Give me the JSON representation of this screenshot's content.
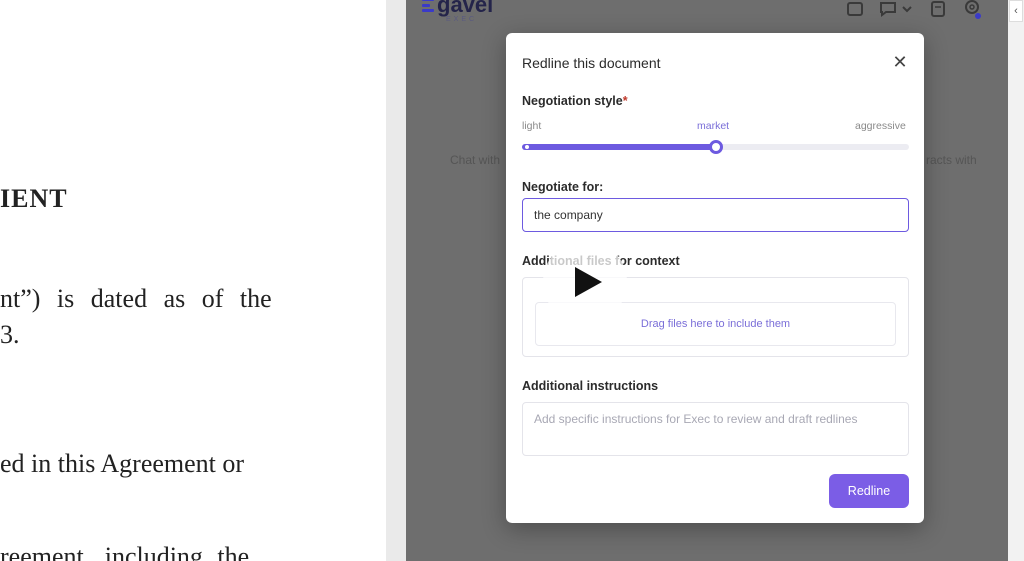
{
  "document": {
    "heading_fragment": "IENT",
    "line1": "nt”) is dated as of the",
    "line2": "3.",
    "line3": "ed in this Agreement or",
    "line4": "reement, including the"
  },
  "app": {
    "logo_text": "gavel",
    "logo_subtext": "EXEC",
    "background_hint_left": "Chat with",
    "background_hint_right": "racts with",
    "collapse_glyph": "‹",
    "accent_color": "#6d5ae0"
  },
  "modal": {
    "title": "Redline this document",
    "close_glyph": "✕",
    "negotiation_style": {
      "label": "Negotiation style",
      "required_mark": "*",
      "min_label": "light",
      "mid_label": "market",
      "max_label": "aggressive",
      "selected": "market",
      "level_fraction": 0.5
    },
    "negotiate_for": {
      "label": "Negotiate for:",
      "value": "the company"
    },
    "additional_files": {
      "label": "Additional files for context",
      "drop_text": "Drag files here to include them"
    },
    "additional_instructions": {
      "label": "Additional instructions",
      "placeholder": "Add specific instructions for Exec to review and draft redlines"
    },
    "submit_label": "Redline"
  },
  "icons": [
    "calendar-icon",
    "chat-icon",
    "chevron-down-icon",
    "document-icon",
    "gear-icon",
    "close-icon",
    "play-icon"
  ]
}
